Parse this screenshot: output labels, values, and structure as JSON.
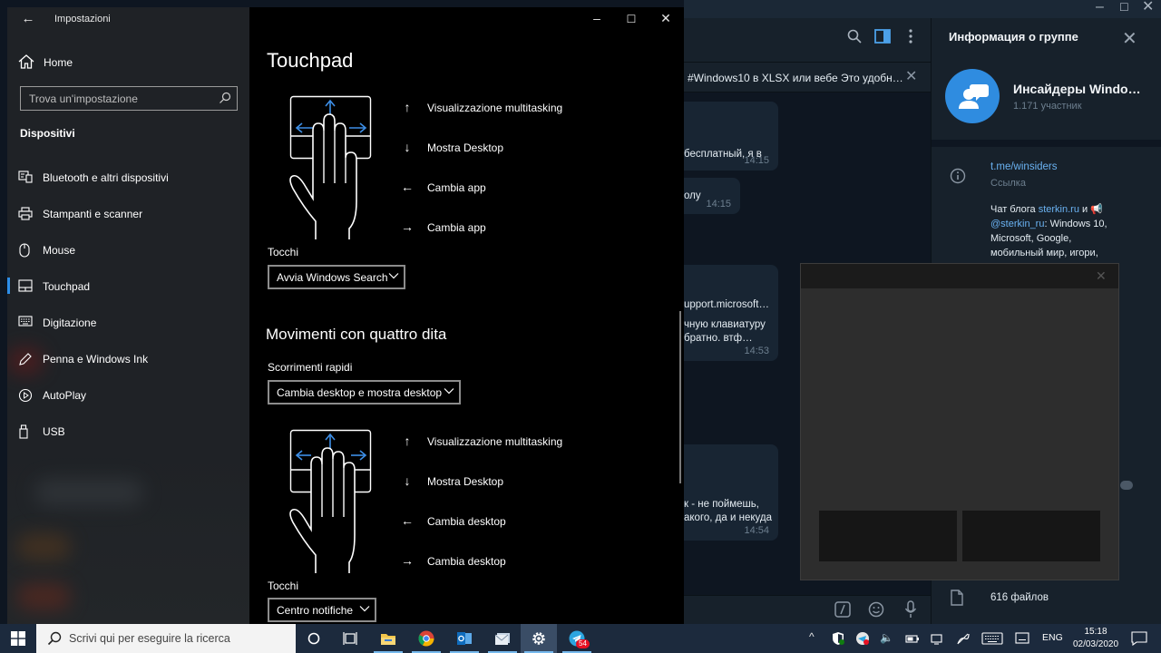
{
  "settings": {
    "window_title": "Impostazioni",
    "home_label": "Home",
    "search_placeholder": "Trova un'impostazione",
    "section_label": "Dispositivi",
    "nav": [
      {
        "label": "Bluetooth e altri dispositivi",
        "icon": "bluetooth-devices-icon"
      },
      {
        "label": "Stampanti e scanner",
        "icon": "printer-icon"
      },
      {
        "label": "Mouse",
        "icon": "mouse-icon"
      },
      {
        "label": "Touchpad",
        "icon": "touchpad-icon",
        "selected": true
      },
      {
        "label": "Digitazione",
        "icon": "keyboard-icon"
      },
      {
        "label": "Penna e Windows Ink",
        "icon": "pen-icon"
      },
      {
        "label": "AutoPlay",
        "icon": "autoplay-icon"
      },
      {
        "label": "USB",
        "icon": "usb-icon"
      }
    ],
    "page_title": "Touchpad",
    "three_finger": {
      "gestures": [
        {
          "direction": "up",
          "label": "Visualizzazione multitasking"
        },
        {
          "direction": "down",
          "label": "Mostra Desktop"
        },
        {
          "direction": "left",
          "label": "Cambia app"
        },
        {
          "direction": "right",
          "label": "Cambia app"
        }
      ],
      "taps_label": "Tocchi",
      "taps_value": "Avvia Windows Search"
    },
    "four_finger": {
      "heading": "Movimenti con quattro dita",
      "swipes_label": "Scorrimenti rapidi",
      "swipes_value": "Cambia desktop e mostra desktop",
      "gestures": [
        {
          "direction": "up",
          "label": "Visualizzazione multitasking"
        },
        {
          "direction": "down",
          "label": "Mostra Desktop"
        },
        {
          "direction": "left",
          "label": "Cambia desktop"
        },
        {
          "direction": "right",
          "label": "Cambia desktop"
        }
      ],
      "taps_label": "Tocchi",
      "taps_value": "Centro notifiche"
    },
    "accent_color": "#2d8ee8"
  },
  "telegram": {
    "pinned_text": "#Windows10 в XLSX или вебе  Это удобн…",
    "messages": [
      {
        "text": "бесплатный, я в",
        "time": "14:15"
      },
      {
        "text": "олу",
        "time": "14:15"
      },
      {
        "text1": "upport.microsoft…",
        "text2": "чную клавиатуру",
        "text3": "братно. втф…",
        "time": "14:53"
      },
      {
        "text1": "к - не поймешь,",
        "text2": "акого, да и некуда",
        "time": "14:54"
      }
    ],
    "info_title": "Информация о группе",
    "group_name": "Инсайдеры Windo…",
    "group_members": "1.171 участник",
    "link": "t.me/winsiders",
    "link_caption": "Ссылка",
    "desc": {
      "p1": "Чат блога ",
      "lnk1": "sterkin.ru",
      "p2": " и ",
      "lnk2": "@sterkin_ru",
      "p3": ": Windows 10, Microsoft, Google, мобильный мир, игори,"
    },
    "files": "616 файлов",
    "accent_color": "#2f8ce0"
  },
  "taskbar": {
    "search_placeholder": "Scrivi qui per eseguire la ricerca",
    "apps": [
      "task-view-icon",
      "file-explorer-icon",
      "chrome-icon",
      "outlook-icon",
      "mail-icon",
      "settings-gear-icon",
      "telegram-icon"
    ],
    "telegram_badge": "54",
    "lang": "ENG",
    "time": "15:18",
    "date": "02/03/2020"
  }
}
